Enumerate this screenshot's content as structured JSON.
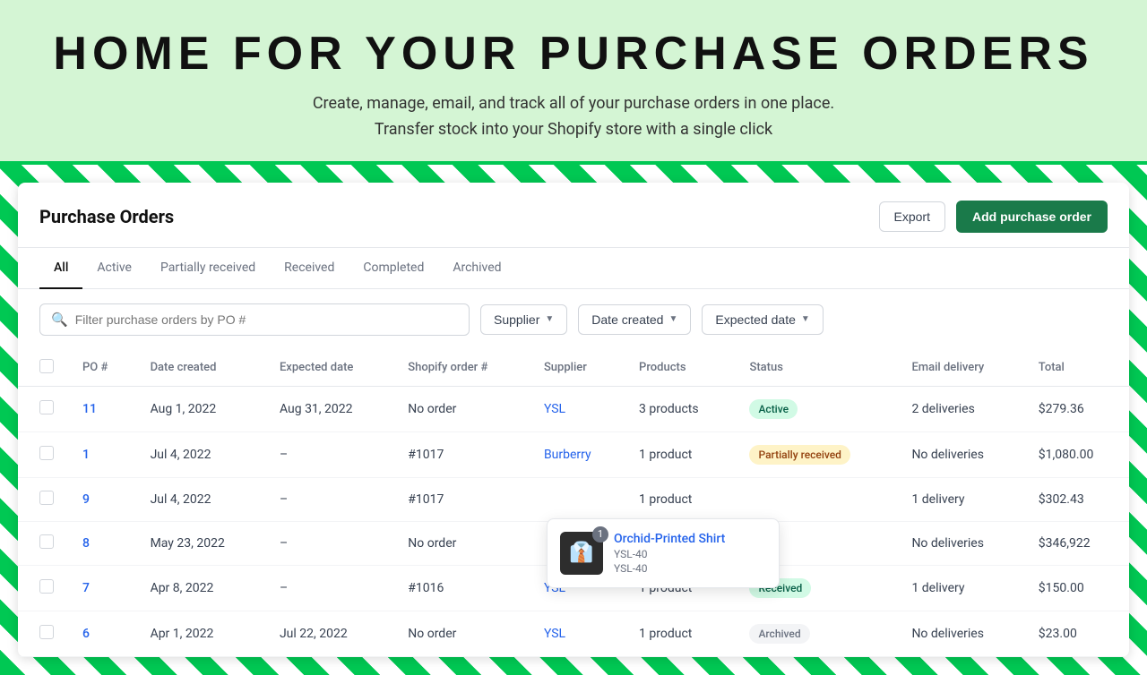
{
  "header": {
    "title": "HOME  FOR  YOUR  PURCHASE  ORDERS",
    "subtitle_line1": "Create, manage, email, and track all of your purchase orders in one place.",
    "subtitle_line2": "Transfer stock into your Shopify store with a single click"
  },
  "po_card": {
    "title": "Purchase Orders",
    "export_label": "Export",
    "add_label": "Add purchase order"
  },
  "tabs": [
    {
      "label": "All",
      "active": true
    },
    {
      "label": "Active",
      "active": false
    },
    {
      "label": "Partially received",
      "active": false
    },
    {
      "label": "Received",
      "active": false
    },
    {
      "label": "Completed",
      "active": false
    },
    {
      "label": "Archived",
      "active": false
    }
  ],
  "filters": {
    "search_placeholder": "Filter purchase orders by PO #",
    "supplier_label": "Supplier",
    "date_created_label": "Date created",
    "expected_date_label": "Expected date"
  },
  "table": {
    "columns": [
      "PO #",
      "Date created",
      "Expected date",
      "Shopify order #",
      "Supplier",
      "Products",
      "Status",
      "Email delivery",
      "Total"
    ],
    "rows": [
      {
        "po": "11",
        "date_created": "Aug 1, 2022",
        "expected_date": "Aug 31, 2022",
        "shopify_order": "No order",
        "supplier": "YSL",
        "products": "3 products",
        "status": "Active",
        "status_type": "active",
        "email_delivery": "2 deliveries",
        "total": "$279.36"
      },
      {
        "po": "1",
        "date_created": "Jul 4, 2022",
        "expected_date": "–",
        "shopify_order": "#1017",
        "supplier": "Burberry",
        "products": "1 product",
        "status": "Partially received",
        "status_type": "partial",
        "email_delivery": "No deliveries",
        "total": "$1,080.00"
      },
      {
        "po": "9",
        "date_created": "Jul 4, 2022",
        "expected_date": "–",
        "shopify_order": "#1017",
        "supplier": "",
        "products": "1 product",
        "status": "",
        "status_type": "",
        "email_delivery": "1 delivery",
        "total": "$302.43"
      },
      {
        "po": "8",
        "date_created": "May 23, 2022",
        "expected_date": "–",
        "shopify_order": "No order",
        "supplier": "",
        "products": "",
        "status": "",
        "status_type": "",
        "email_delivery": "No deliveries",
        "total": "$346,922"
      },
      {
        "po": "7",
        "date_created": "Apr 8, 2022",
        "expected_date": "–",
        "shopify_order": "#1016",
        "supplier": "YSL",
        "products": "1 product",
        "status": "Received",
        "status_type": "received",
        "email_delivery": "1 delivery",
        "total": "$150.00"
      },
      {
        "po": "6",
        "date_created": "Apr 1, 2022",
        "expected_date": "Jul 22, 2022",
        "shopify_order": "No order",
        "supplier": "YSL",
        "products": "1 product",
        "status": "Archived",
        "status_type": "archived",
        "email_delivery": "No deliveries",
        "total": "$23.00"
      }
    ]
  },
  "tooltip": {
    "badge_count": "1",
    "product_name": "Orchid-Printed Shirt",
    "sku1": "YSL-40",
    "sku2": "YSL-40"
  }
}
